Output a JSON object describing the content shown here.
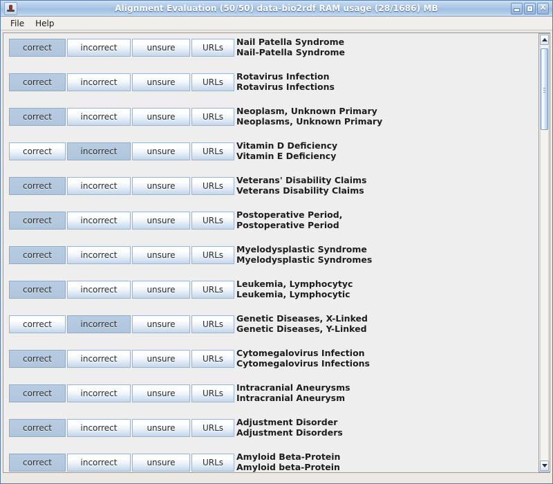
{
  "window": {
    "title": "Alignment Evaluation (50/50) data-bio2rdf RAM usage (28/1686) MB",
    "app_icon": "java-app-icon",
    "controls": {
      "minimize": "minimize-button",
      "maximize": "maximize-button",
      "close_label": "X"
    }
  },
  "menubar": {
    "items": [
      {
        "label": "File"
      },
      {
        "label": "Help"
      }
    ]
  },
  "buttons": {
    "correct": "correct",
    "incorrect": "incorrect",
    "unsure": "unsure",
    "urls": "URLs"
  },
  "colors": {
    "titlebar_accent": "#a9c6e5",
    "selected_button": "#b4cae0",
    "content_background": "#eeeeee",
    "text": "#1d1d1d"
  },
  "rows": [
    {
      "selected": "correct",
      "source": "Nail Patella Syndrome",
      "target": "Nail-Patella Syndrome"
    },
    {
      "selected": "correct",
      "source": "Rotavirus Infection",
      "target": "Rotavirus Infections"
    },
    {
      "selected": "correct",
      "source": "Neoplasm, Unknown Primary",
      "target": "Neoplasms, Unknown Primary"
    },
    {
      "selected": "incorrect",
      "source": "Vitamin D Deficiency",
      "target": "Vitamin E Deficiency"
    },
    {
      "selected": "correct",
      "source": "Veterans' Disability Claims",
      "target": "Veterans Disability Claims"
    },
    {
      "selected": "correct",
      "source": "Postoperative Period,",
      "target": "Postoperative Period"
    },
    {
      "selected": "correct",
      "source": "Myelodysplastic Syndrome",
      "target": "Myelodysplastic Syndromes"
    },
    {
      "selected": "correct",
      "source": "Leukemia, Lymphocytyc",
      "target": "Leukemia, Lymphocytic"
    },
    {
      "selected": "incorrect",
      "source": "Genetic Diseases, X-Linked",
      "target": "Genetic Diseases, Y-Linked"
    },
    {
      "selected": "correct",
      "source": "Cytomegalovirus Infection",
      "target": "Cytomegalovirus Infections"
    },
    {
      "selected": "correct",
      "source": "Intracranial Aneurysms",
      "target": "Intracranial Aneurysm"
    },
    {
      "selected": "correct",
      "source": "Adjustment Disorder",
      "target": "Adjustment Disorders"
    },
    {
      "selected": "correct",
      "source": "Amyloid Beta-Protein",
      "target": "Amyloid beta-Protein"
    }
  ],
  "scrollbar": {
    "up_icon": "scroll-up-arrow-icon",
    "down_icon": "scroll-down-arrow-icon"
  }
}
